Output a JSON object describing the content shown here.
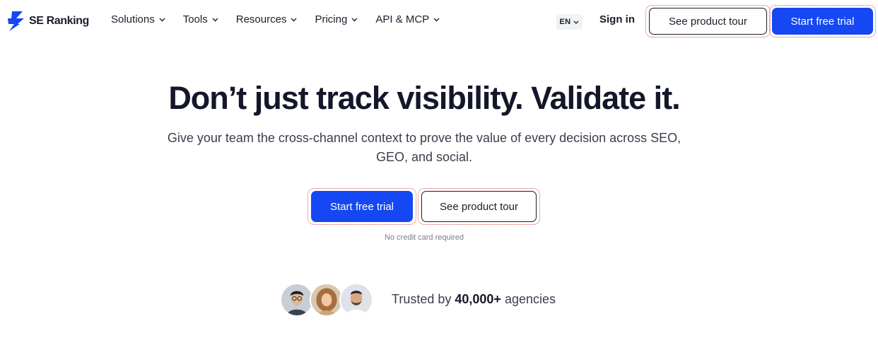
{
  "brand": {
    "name": "SE Ranking",
    "accent": "#1548f2"
  },
  "nav": {
    "items": [
      {
        "label": "Solutions"
      },
      {
        "label": "Tools"
      },
      {
        "label": "Resources"
      },
      {
        "label": "Pricing"
      },
      {
        "label": "API & MCP"
      }
    ],
    "language": "EN",
    "sign_in": "Sign in",
    "tour_label": "See product tour",
    "trial_label": "Start free trial"
  },
  "hero": {
    "title": "Don’t just track visibility. Validate it.",
    "subtitle": "Give your team the cross-channel context to prove the value of every decision across SEO, GEO, and social.",
    "primary_cta": "Start free trial",
    "secondary_cta": "See product tour",
    "note": "No credit card required"
  },
  "trust": {
    "prefix": "Trusted by ",
    "count": "40,000+",
    "suffix": " agencies",
    "avatar_icons": [
      "avatar-man-glasses",
      "avatar-woman-curly-hair",
      "avatar-man-beard"
    ]
  }
}
